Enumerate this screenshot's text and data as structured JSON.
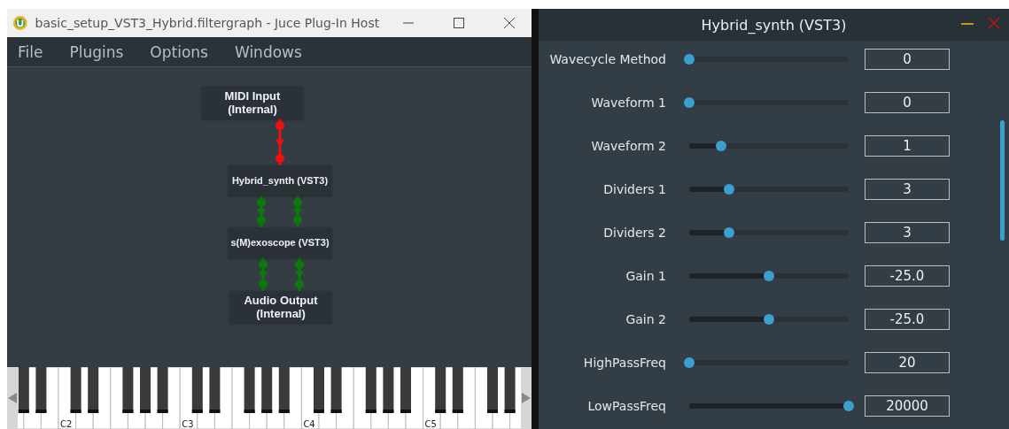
{
  "host_window": {
    "title": "basic_setup_VST3_Hybrid.filtergraph - Juce Plug-In Host",
    "menu": [
      "File",
      "Plugins",
      "Options",
      "Windows"
    ],
    "graph": {
      "nodes": [
        {
          "label": "MIDI Input\n(Internal)",
          "kind": "io"
        },
        {
          "label": "Hybrid_synth (VST3)",
          "kind": "plugin"
        },
        {
          "label": "s(M)exoscope (VST3)",
          "kind": "plugin"
        },
        {
          "label": "Audio Output\n(Internal)",
          "kind": "io"
        }
      ],
      "connections": [
        {
          "kind": "midi"
        },
        {
          "kind": "audio"
        },
        {
          "kind": "audio"
        }
      ]
    },
    "keyboard": {
      "octave_labels": [
        "C2",
        "C3",
        "C4",
        "C5"
      ]
    }
  },
  "plugin_window": {
    "title": "Hybrid_synth (VST3)",
    "parameters": [
      {
        "name": "Wavecycle Method",
        "level": 0,
        "value": "0"
      },
      {
        "name": "Waveform 1",
        "level": 0,
        "value": "0"
      },
      {
        "name": "Waveform 2",
        "level": 0.2,
        "value": "1"
      },
      {
        "name": "Dividers 1",
        "level": 0.25,
        "value": "3"
      },
      {
        "name": "Dividers 2",
        "level": 0.25,
        "value": "3"
      },
      {
        "name": "Gain 1",
        "level": 0.5,
        "value": "-25.0"
      },
      {
        "name": "Gain 2",
        "level": 0.5,
        "value": "-25.0"
      },
      {
        "name": "HighPassFreq",
        "level": 0,
        "value": "20"
      },
      {
        "name": "LowPassFreq",
        "level": 1,
        "value": "20000"
      }
    ]
  }
}
